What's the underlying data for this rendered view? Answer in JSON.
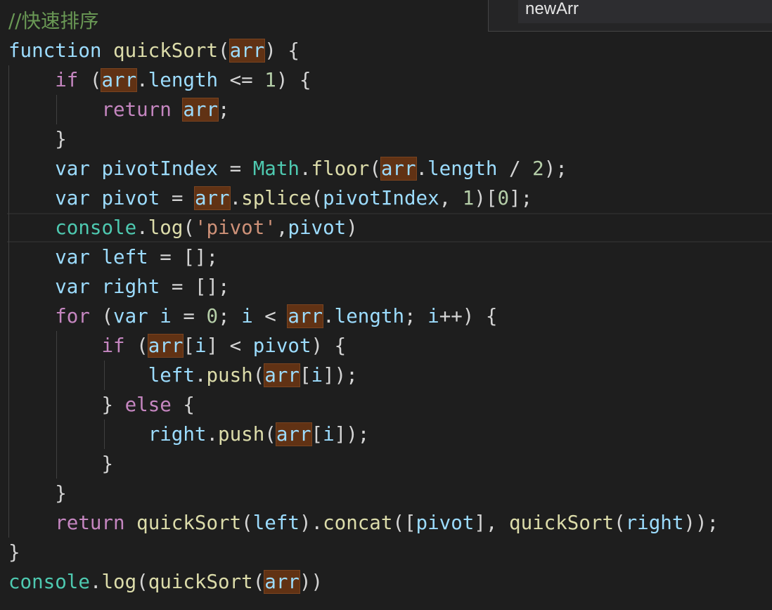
{
  "editor": {
    "lines": [
      [
        {
          "t": "//快速排序",
          "c": "com"
        }
      ],
      [
        {
          "t": "function",
          "c": "id"
        },
        {
          "t": " "
        },
        {
          "t": "quickSort",
          "c": "fn"
        },
        {
          "t": "("
        },
        {
          "t": "arr",
          "c": "id",
          "h": 1
        },
        {
          "t": ") {"
        }
      ],
      [
        {
          "t": "    "
        },
        {
          "t": "if",
          "c": "kw"
        },
        {
          "t": " ("
        },
        {
          "t": "arr",
          "c": "id",
          "h": 1
        },
        {
          "t": "."
        },
        {
          "t": "length",
          "c": "id"
        },
        {
          "t": " <= "
        },
        {
          "t": "1",
          "c": "num"
        },
        {
          "t": ") {"
        }
      ],
      [
        {
          "t": "        "
        },
        {
          "t": "return",
          "c": "kw"
        },
        {
          "t": " "
        },
        {
          "t": "arr",
          "c": "id",
          "h": 1
        },
        {
          "t": ";"
        }
      ],
      [
        {
          "t": "    }"
        }
      ],
      [
        {
          "t": "    "
        },
        {
          "t": "var",
          "c": "id"
        },
        {
          "t": " "
        },
        {
          "t": "pivotIndex",
          "c": "id"
        },
        {
          "t": " = "
        },
        {
          "t": "Math",
          "c": "cls"
        },
        {
          "t": "."
        },
        {
          "t": "floor",
          "c": "fn"
        },
        {
          "t": "("
        },
        {
          "t": "arr",
          "c": "id",
          "h": 1
        },
        {
          "t": "."
        },
        {
          "t": "length",
          "c": "id"
        },
        {
          "t": " / "
        },
        {
          "t": "2",
          "c": "num"
        },
        {
          "t": ");"
        }
      ],
      [
        {
          "t": "    "
        },
        {
          "t": "var",
          "c": "id"
        },
        {
          "t": " "
        },
        {
          "t": "pivot",
          "c": "id"
        },
        {
          "t": " = "
        },
        {
          "t": "arr",
          "c": "id",
          "h": 1
        },
        {
          "t": "."
        },
        {
          "t": "splice",
          "c": "fn"
        },
        {
          "t": "("
        },
        {
          "t": "pivotIndex",
          "c": "id"
        },
        {
          "t": ", "
        },
        {
          "t": "1",
          "c": "num"
        },
        {
          "t": ")["
        },
        {
          "t": "0",
          "c": "num"
        },
        {
          "t": "];"
        }
      ],
      [
        {
          "t": "    "
        },
        {
          "t": "console",
          "c": "cls"
        },
        {
          "t": "."
        },
        {
          "t": "log",
          "c": "fn"
        },
        {
          "t": "("
        },
        {
          "t": "'pivot'",
          "c": "str"
        },
        {
          "t": ","
        },
        {
          "t": "pivot",
          "c": "id"
        },
        {
          "t": ")"
        }
      ],
      [
        {
          "t": "    "
        },
        {
          "t": "var",
          "c": "id"
        },
        {
          "t": " "
        },
        {
          "t": "left",
          "c": "id"
        },
        {
          "t": " = [];"
        }
      ],
      [
        {
          "t": "    "
        },
        {
          "t": "var",
          "c": "id"
        },
        {
          "t": " "
        },
        {
          "t": "right",
          "c": "id"
        },
        {
          "t": " = [];"
        }
      ],
      [
        {
          "t": "    "
        },
        {
          "t": "for",
          "c": "kw"
        },
        {
          "t": " ("
        },
        {
          "t": "var",
          "c": "id"
        },
        {
          "t": " "
        },
        {
          "t": "i",
          "c": "id"
        },
        {
          "t": " = "
        },
        {
          "t": "0",
          "c": "num"
        },
        {
          "t": "; "
        },
        {
          "t": "i",
          "c": "id"
        },
        {
          "t": " < "
        },
        {
          "t": "arr",
          "c": "id",
          "h": 1
        },
        {
          "t": "."
        },
        {
          "t": "length",
          "c": "id"
        },
        {
          "t": "; "
        },
        {
          "t": "i",
          "c": "id"
        },
        {
          "t": "++) {"
        }
      ],
      [
        {
          "t": "        "
        },
        {
          "t": "if",
          "c": "kw"
        },
        {
          "t": " ("
        },
        {
          "t": "arr",
          "c": "id",
          "h": 1
        },
        {
          "t": "["
        },
        {
          "t": "i",
          "c": "id"
        },
        {
          "t": "] < "
        },
        {
          "t": "pivot",
          "c": "id"
        },
        {
          "t": ") {"
        }
      ],
      [
        {
          "t": "            "
        },
        {
          "t": "left",
          "c": "id"
        },
        {
          "t": "."
        },
        {
          "t": "push",
          "c": "fn"
        },
        {
          "t": "("
        },
        {
          "t": "arr",
          "c": "id",
          "h": 1
        },
        {
          "t": "["
        },
        {
          "t": "i",
          "c": "id"
        },
        {
          "t": "]);"
        }
      ],
      [
        {
          "t": "        } "
        },
        {
          "t": "else",
          "c": "kw"
        },
        {
          "t": " {"
        }
      ],
      [
        {
          "t": "            "
        },
        {
          "t": "right",
          "c": "id"
        },
        {
          "t": "."
        },
        {
          "t": "push",
          "c": "fn"
        },
        {
          "t": "("
        },
        {
          "t": "arr",
          "c": "id",
          "h": 1
        },
        {
          "t": "["
        },
        {
          "t": "i",
          "c": "id"
        },
        {
          "t": "]);"
        }
      ],
      [
        {
          "t": "        }"
        }
      ],
      [
        {
          "t": "    }"
        }
      ],
      [
        {
          "t": "    "
        },
        {
          "t": "return",
          "c": "kw"
        },
        {
          "t": " "
        },
        {
          "t": "quickSort",
          "c": "fn"
        },
        {
          "t": "("
        },
        {
          "t": "left",
          "c": "id"
        },
        {
          "t": ")."
        },
        {
          "t": "concat",
          "c": "fn"
        },
        {
          "t": "(["
        },
        {
          "t": "pivot",
          "c": "id"
        },
        {
          "t": "], "
        },
        {
          "t": "quickSort",
          "c": "fn"
        },
        {
          "t": "("
        },
        {
          "t": "right",
          "c": "id"
        },
        {
          "t": "));"
        }
      ],
      [
        {
          "t": "}"
        }
      ],
      [
        {
          "t": "console",
          "c": "cls"
        },
        {
          "t": "."
        },
        {
          "t": "log",
          "c": "fn"
        },
        {
          "t": "("
        },
        {
          "t": "quickSort",
          "c": "fn"
        },
        {
          "t": "("
        },
        {
          "t": "arr",
          "c": "id",
          "h": 1
        },
        {
          "t": "))"
        }
      ]
    ]
  },
  "suggestion": {
    "label": "newArr"
  },
  "colors": {
    "background": "#1e1e1e",
    "keyword": "#c586c0",
    "function": "#dcdcaa",
    "identifier": "#9cdcfe",
    "number": "#b5cea8",
    "string": "#ce9178",
    "class": "#4ec9b0",
    "comment": "#6a9955",
    "highlight": "#613214"
  }
}
